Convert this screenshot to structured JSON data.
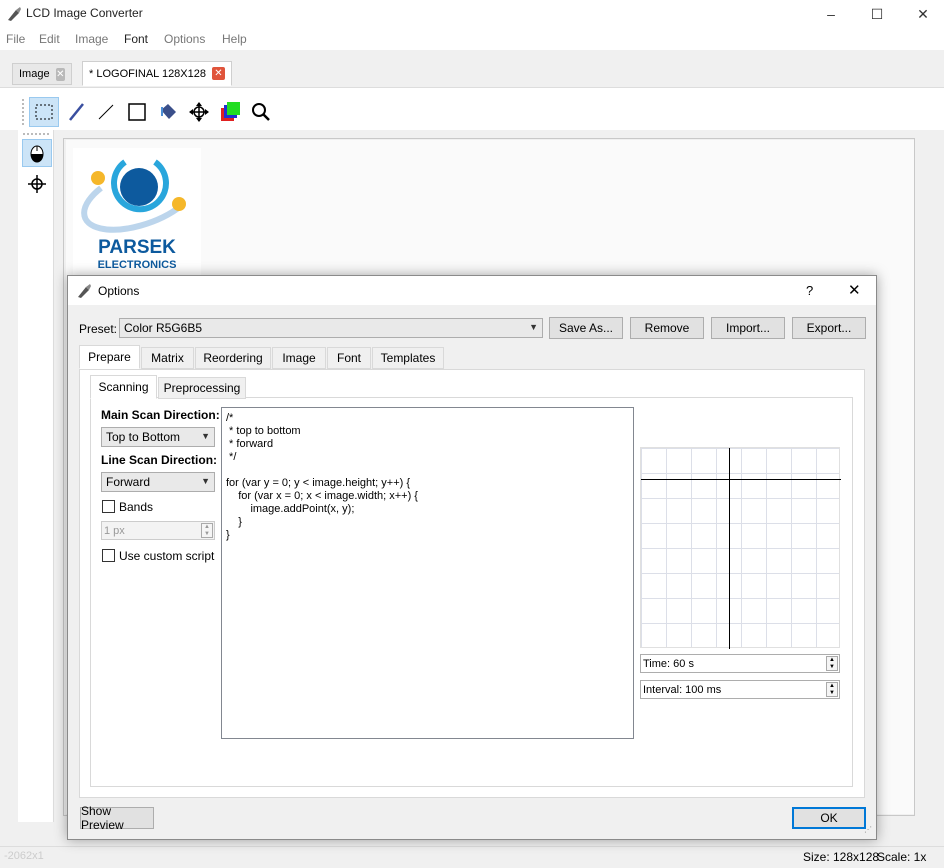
{
  "window": {
    "title": "LCD Image Converter",
    "controls": {
      "minimize": "–",
      "maximize": "☐",
      "close": "✕"
    }
  },
  "menu": [
    "File",
    "Edit",
    "Image",
    "Font",
    "Options",
    "Help"
  ],
  "doc_tabs": [
    {
      "label": "Image",
      "close": "✕",
      "active": false
    },
    {
      "label": "* LOGOFINAL 128X128",
      "close": "✕",
      "active": true
    }
  ],
  "toolbar": {
    "icons": [
      "select-icon",
      "pen-icon",
      "line-icon",
      "rectangle-icon",
      "fill-icon",
      "move-icon",
      "color-icon",
      "zoom-icon"
    ]
  },
  "logo": {
    "text1": "PARSEK",
    "text2": "ELECTRONICS"
  },
  "status": {
    "size": "Size: 128x128",
    "scale": "Scale: 1x",
    "left": "-2062x1"
  },
  "dialog": {
    "title": "Options",
    "help": "?",
    "close": "✕",
    "preset_label": "Preset:",
    "preset_value": "Color R5G6B5",
    "buttons": {
      "save_as": "Save As...",
      "remove": "Remove",
      "import": "Import...",
      "export": "Export...",
      "ok": "OK",
      "show_preview": "Show Preview"
    },
    "tabs": [
      "Prepare",
      "Matrix",
      "Reordering",
      "Image",
      "Font",
      "Templates"
    ],
    "subtabs": [
      "Scanning",
      "Preprocessing"
    ],
    "main_scan_label": "Main Scan Direction:",
    "main_scan_value": "Top to Bottom",
    "line_scan_label": "Line Scan Direction:",
    "line_scan_value": "Forward",
    "bands_label": "Bands",
    "bands_value": "1 px",
    "custom_script_label": "Use custom script",
    "script": "/*\n * top to bottom\n * forward\n */\n\nfor (var y = 0; y < image.height; y++) {\n    for (var x = 0; x < image.width; x++) {\n        image.addPoint(x, y);\n    }\n}",
    "time": "Time: 60 s",
    "interval": "Interval: 100 ms"
  },
  "colors": {
    "accent_close": "#e0543b",
    "logo_blue": "#0d5a9e",
    "logo_yellow": "#f5b72a"
  }
}
